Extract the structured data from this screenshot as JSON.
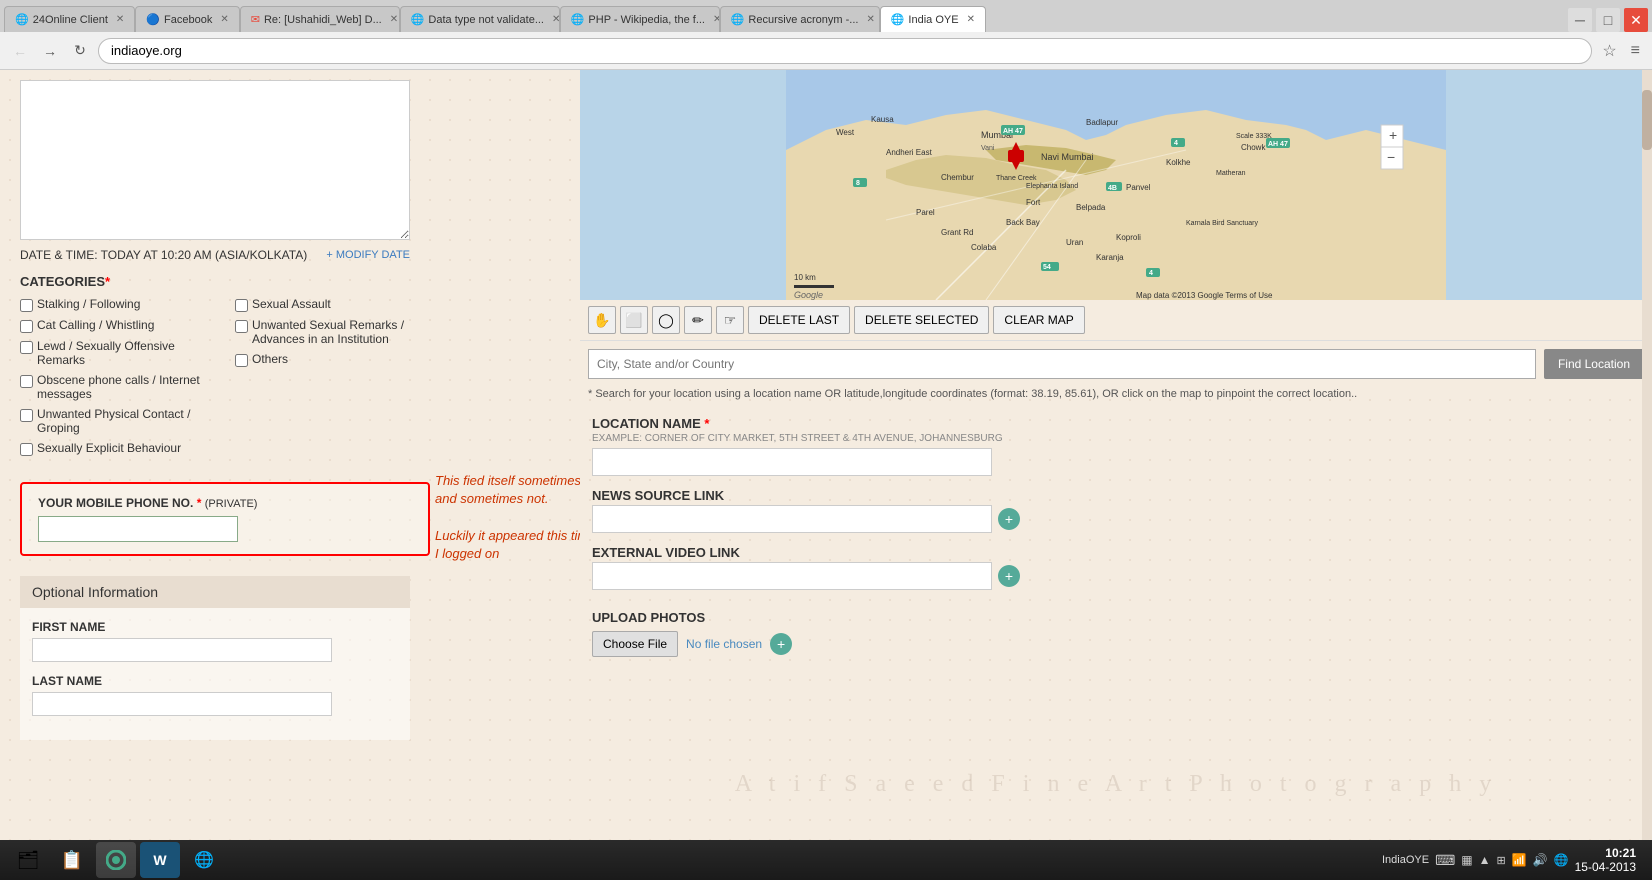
{
  "browser": {
    "tabs": [
      {
        "id": "24online",
        "label": "24Online Client",
        "active": false,
        "favicon": "🌐"
      },
      {
        "id": "facebook",
        "label": "Facebook",
        "active": false,
        "favicon": "🔵"
      },
      {
        "id": "gmail",
        "label": "Re: [Ushahidi_Web] D...",
        "active": false,
        "favicon": "✉"
      },
      {
        "id": "datatype",
        "label": "Data type not validate...",
        "active": false,
        "favicon": "🌐"
      },
      {
        "id": "php",
        "label": "PHP - Wikipedia, the f...",
        "active": false,
        "favicon": "🌐"
      },
      {
        "id": "recursive",
        "label": "Recursive acronym -...",
        "active": false,
        "favicon": "🌐"
      },
      {
        "id": "indiaoye",
        "label": "India OYE",
        "active": true,
        "favicon": "🌐"
      }
    ],
    "address": "indiaoye.org"
  },
  "form": {
    "datetime_label": "DATE & TIME: TODAY AT 10:20 AM (ASIA/KOLKATA)",
    "modify_date_link": "MODIFY DATE",
    "categories_label": "CATEGORIES",
    "categories_required": "*",
    "categories_left": [
      {
        "label": "Stalking / Following"
      },
      {
        "label": "Cat Calling / Whistling"
      },
      {
        "label": "Lewd / Sexually Offensive Remarks"
      },
      {
        "label": "Obscene phone calls / Internet messages"
      },
      {
        "label": "Unwanted Physical Contact / Groping"
      },
      {
        "label": "Sexually Explicit Behaviour"
      }
    ],
    "categories_right": [
      {
        "label": "Sexual Assault"
      },
      {
        "label": "Unwanted Sexual Remarks / Advances in an Institution"
      },
      {
        "label": "Others"
      }
    ],
    "phone_label": "YOUR MOBILE PHONE NO.",
    "phone_required": "*",
    "phone_private": "(PRIVATE)",
    "phone_placeholder": "",
    "annotation_line1": "This fied itself",
    "annotation_line2": "sometimes appears and",
    "annotation_line3": "sometimes not.",
    "annotation_line4": "",
    "annotation_line5": "Luckily it appeared this",
    "annotation_line6": "time when I logged on",
    "optional_header": "Optional Information",
    "first_name_label": "FIRST NAME",
    "last_name_label": "LAST NAME"
  },
  "map": {
    "city_placeholder": "City, State and/or Country",
    "find_btn_label": "Find Location",
    "delete_last_label": "DELETE LAST",
    "delete_selected_label": "DELETE SELECTED",
    "clear_map_label": "CLEAR MAP",
    "hint": "* Search for your location using a location name OR latitude,longitude coordinates (format: 38.19, 85.61), OR click on the map to pinpoint the correct location..",
    "location_name_label": "LOCATION NAME",
    "location_name_required": "*",
    "location_example": "EXAMPLE: CORNER OF CITY MARKET, 5TH STREET & 4TH AVENUE, JOHANNESBURG",
    "news_source_label": "NEWS SOURCE LINK",
    "external_video_label": "EXTERNAL VIDEO LINK",
    "upload_photos_label": "UPLOAD PHOTOS",
    "choose_file_label": "Choose File",
    "no_file_label": "No file chosen"
  },
  "taskbar": {
    "items": [
      {
        "icon": "🗂",
        "name": "files"
      },
      {
        "icon": "📋",
        "name": "notes"
      },
      {
        "icon": "🌐",
        "name": "chrome"
      },
      {
        "icon": "W",
        "name": "word"
      },
      {
        "icon": "🌐",
        "name": "ie"
      }
    ],
    "india_oye_label": "IndiaOYE",
    "keyboard_icon": "⌨",
    "time": "10:21",
    "date": "15-04-2013"
  },
  "watermark": "A t i f   S a e e d   F i n e   A r t   P h o t o g r a p h y"
}
